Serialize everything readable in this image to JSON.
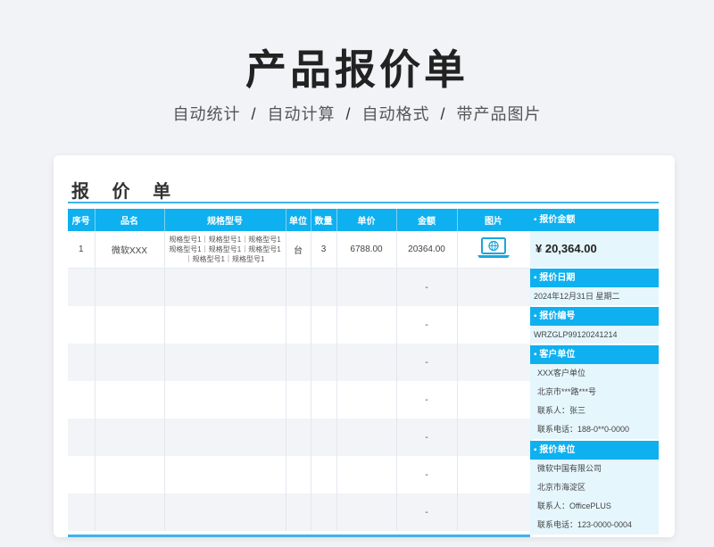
{
  "page": {
    "title": "产品报价单",
    "subtitle": [
      "自动统计",
      "自动计算",
      "自动格式",
      "带产品图片"
    ],
    "separator": "/"
  },
  "card": {
    "title": "报 价 单"
  },
  "table": {
    "headers": [
      "序号",
      "品名",
      "规格型号",
      "单位",
      "数量",
      "单价",
      "金额",
      "图片"
    ],
    "row1": {
      "index": "1",
      "name": "微软XXX",
      "spec": "规格型号1｜规格型号1｜规格型号1 规格型号1｜规格型号1｜规格型号1 ｜规格型号1｜规格型号1",
      "unit": "台",
      "qty": "3",
      "price": "6788.00",
      "amount": "20364.00",
      "picture_icon": "laptop-globe-icon"
    },
    "empty_amount": "-"
  },
  "panel": {
    "total_label": "▪ 报价金额",
    "total_value": "¥ 20,364.00",
    "date_label": "▪ 报价日期",
    "date_value": "2024年12月31日  星期二",
    "code_label": "▪ 报价编号",
    "code_value": "WRZGLP99120241214",
    "customer_label": "▪ 客户单位",
    "customer": [
      "XXX客户单位",
      "北京市***路***号",
      "联系人：张三",
      "联系电话：188-0**0-0000"
    ],
    "vendor_label": "▪ 报价单位",
    "vendor": [
      "微软中国有限公司",
      "北京市海淀区",
      "联系人：OfficePLUS",
      "联系电话：123-0000-0004"
    ]
  },
  "colors": {
    "accent": "#0fb0ef",
    "panel_bg": "#e5f6fd"
  }
}
